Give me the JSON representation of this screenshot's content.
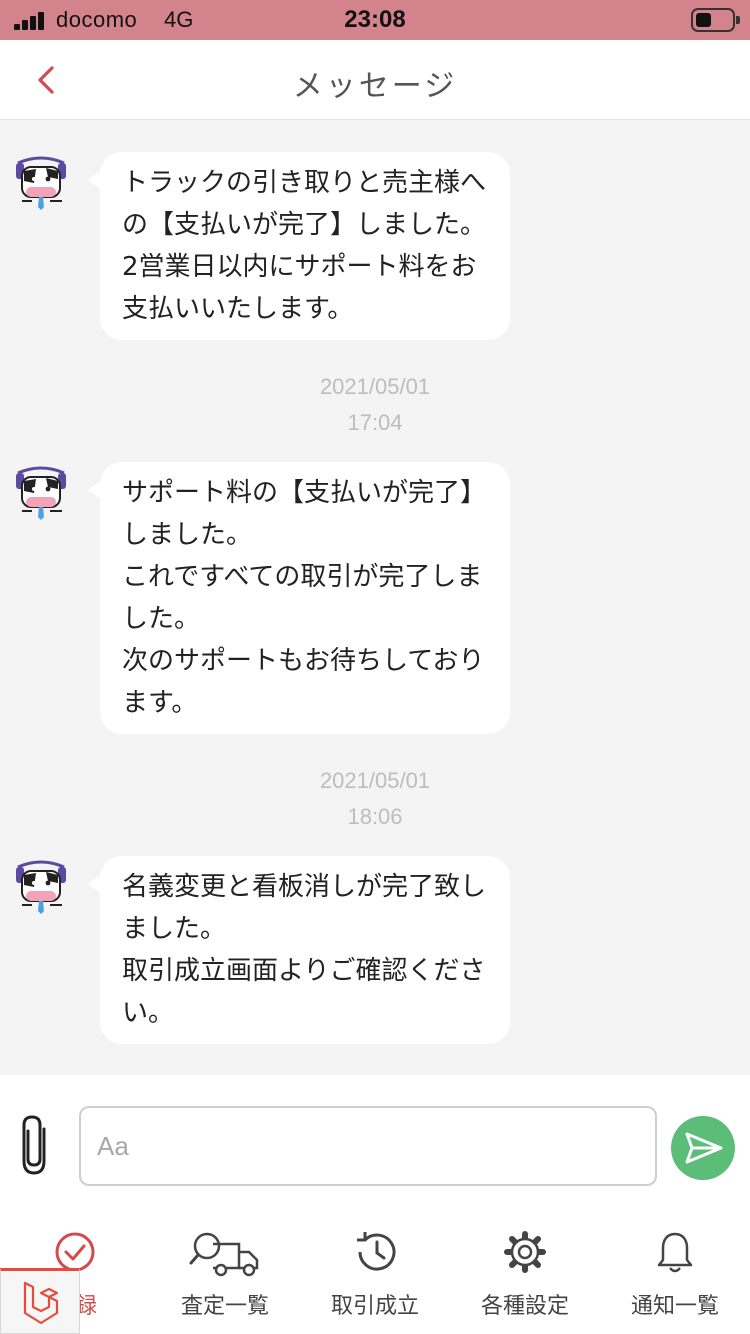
{
  "status_bar": {
    "carrier": "docomo",
    "network": "4G",
    "time": "23:08"
  },
  "header": {
    "back_icon": "chevron-left-icon",
    "title": "メッセージ"
  },
  "messages": [
    {
      "text": "トラックの引き取りと売主様へ\nの【支払いが完了】しました。\n2営業日以内にサポート料をお\n支払いいたします。"
    },
    {
      "date": "2021/05/01",
      "time": "17:04",
      "text": "サポート料の【支払いが完了】\nしました。\nこれですべての取引が完了しま\nした。\n次のサポートもお待ちしており\nます。"
    },
    {
      "date": "2021/05/01",
      "time": "18:06",
      "text": "名義変更と看板消しが完了致し\nました。\n取引成立画面よりご確認くださ\nい。"
    }
  ],
  "composer": {
    "attach_icon": "paperclip-icon",
    "placeholder": "Aa",
    "send_icon": "send-icon"
  },
  "tabs": [
    {
      "label": "登録",
      "icon": "check-circle-icon",
      "active": true
    },
    {
      "label": "査定一覧",
      "icon": "search-truck-icon",
      "active": false
    },
    {
      "label": "取引成立",
      "icon": "history-icon",
      "active": false
    },
    {
      "label": "各種設定",
      "icon": "gear-icon",
      "active": false
    },
    {
      "label": "通知一覧",
      "icon": "bell-icon",
      "active": false
    }
  ],
  "colors": {
    "status_bar": "#d3838c",
    "accent_red": "#d44a4a",
    "send_green": "#5cbd79",
    "timestamp_gray": "#bdbdbd",
    "chat_bg": "#f4f4f4"
  }
}
